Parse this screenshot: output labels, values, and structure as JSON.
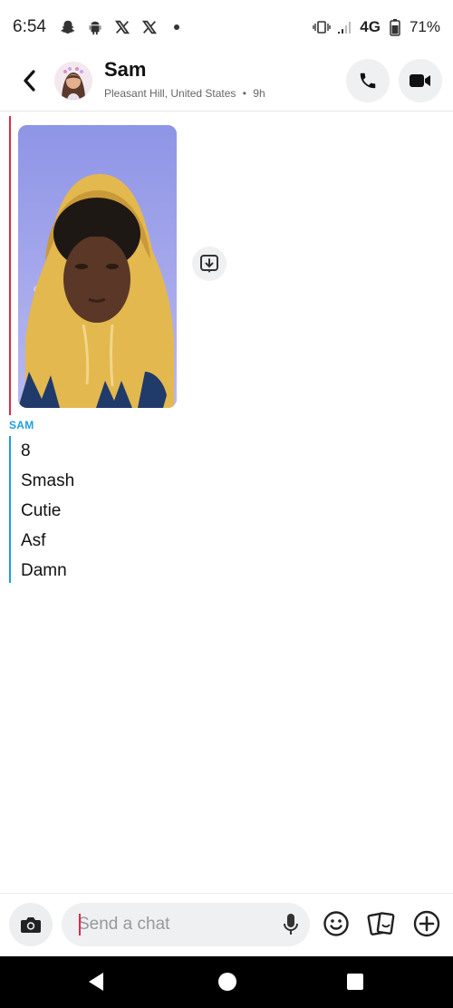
{
  "status_bar": {
    "time": "6:54",
    "network": "4G",
    "battery": "71%",
    "icons": [
      "snapchat-icon",
      "android-icon",
      "x-icon",
      "x-icon",
      "dot-icon",
      "vibrate-icon",
      "signal-icon",
      "battery-icon"
    ]
  },
  "header": {
    "contact_name": "Sam",
    "location": "Pleasant Hill, United States",
    "separator": "•",
    "time_ago": "9h"
  },
  "chat": {
    "sender_label": "SAM",
    "messages": [
      "8",
      "Smash",
      "Cutie",
      "Asf",
      "Damn"
    ]
  },
  "composer": {
    "placeholder": "Send a chat"
  },
  "colors": {
    "accent_red": "#e0284a",
    "accent_blue": "#1f9fe0",
    "bubble_bg": "#eef0f2"
  }
}
